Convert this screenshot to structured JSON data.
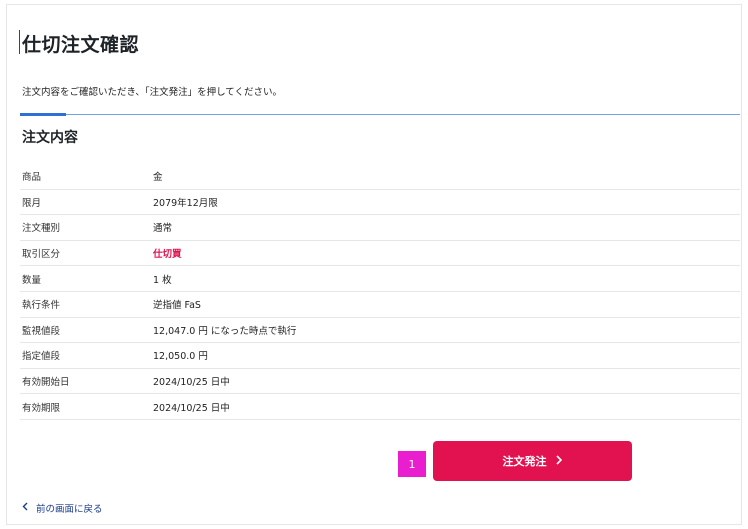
{
  "page": {
    "title": "仕切注文確認",
    "instruction": "注文内容をご確認いただき、「注文発注」を押してください。"
  },
  "section": {
    "title": "注文内容"
  },
  "details": [
    {
      "label": "商品",
      "value": "金"
    },
    {
      "label": "限月",
      "value": "2079年12月限"
    },
    {
      "label": "注文種別",
      "value": "通常"
    },
    {
      "label": "取引区分",
      "value": "仕切買"
    },
    {
      "label": "数量",
      "value": "1 枚"
    },
    {
      "label": "執行条件",
      "value": "逆指値 FaS"
    },
    {
      "label": "監視値段",
      "value": "12,047.0 円 になった時点で執行"
    },
    {
      "label": "指定値段",
      "value": "12,050.0 円"
    },
    {
      "label": "有効開始日",
      "value": "2024/10/25 日中"
    },
    {
      "label": "有効期限",
      "value": "2024/10/25 日中"
    }
  ],
  "actions": {
    "badge": "1",
    "order_label": "注文発注",
    "back_label": "前の画面に戻る"
  },
  "colors": {
    "accent": "#e2114f",
    "badge": "#e91fcf",
    "tab": "#2f6fd6"
  }
}
